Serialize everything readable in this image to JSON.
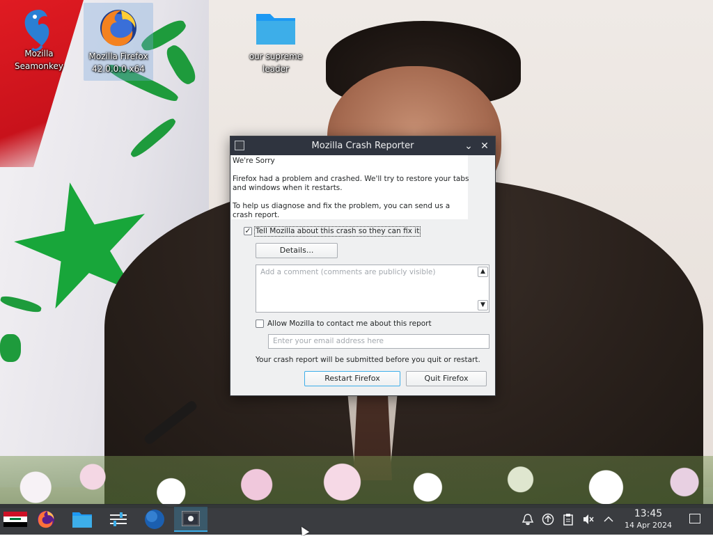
{
  "desktop": {
    "icons": [
      {
        "label_line1": "Mozilla",
        "label_line2": "Seamonkey",
        "icon": "seamonkey-icon"
      },
      {
        "label_line1": "Mozilla Firefox",
        "label_line2": "42.0.0.0 x64",
        "icon": "firefox-icon"
      },
      {
        "label_line1": "our supreme",
        "label_line2": "leader",
        "icon": "folder-icon"
      }
    ]
  },
  "dialog": {
    "title": "Mozilla Crash Reporter",
    "heading": "We're Sorry",
    "message_line1": "Firefox had a problem and crashed. We'll try to restore your tabs",
    "message_line2": "and windows when it restarts.",
    "help_line1": "To help us diagnose and fix the problem, you can send us a",
    "help_line2": "crash report.",
    "tell_mozilla_label": "Tell Mozilla about this crash so they can fix it",
    "tell_mozilla_checked": true,
    "details_button": "Details...",
    "comment_placeholder": "Add a comment (comments are publicly visible)",
    "contact_label": "Allow Mozilla to contact me about this report",
    "contact_checked": false,
    "email_placeholder": "Enter your email address here",
    "submit_note": "Your crash report will be submitted before you quit or restart.",
    "restart_button": "Restart Firefox",
    "quit_button": "Quit Firefox"
  },
  "taskbar": {
    "items": [
      "application-launcher-icon",
      "firefox-icon",
      "file-manager-icon",
      "settings-icon",
      "web-browser-icon",
      "crash-reporter-icon"
    ],
    "tray": [
      "notifications-icon",
      "updates-icon",
      "clipboard-icon",
      "volume-muted-icon",
      "show-hidden-icons-chevron"
    ],
    "time": "13:45",
    "date": "14 Apr 2024"
  },
  "colors": {
    "titlebar": "#2f343f",
    "dialog_bg": "#eff0f1",
    "accent": "#3daee9",
    "taskbar": "#2a2e32"
  }
}
